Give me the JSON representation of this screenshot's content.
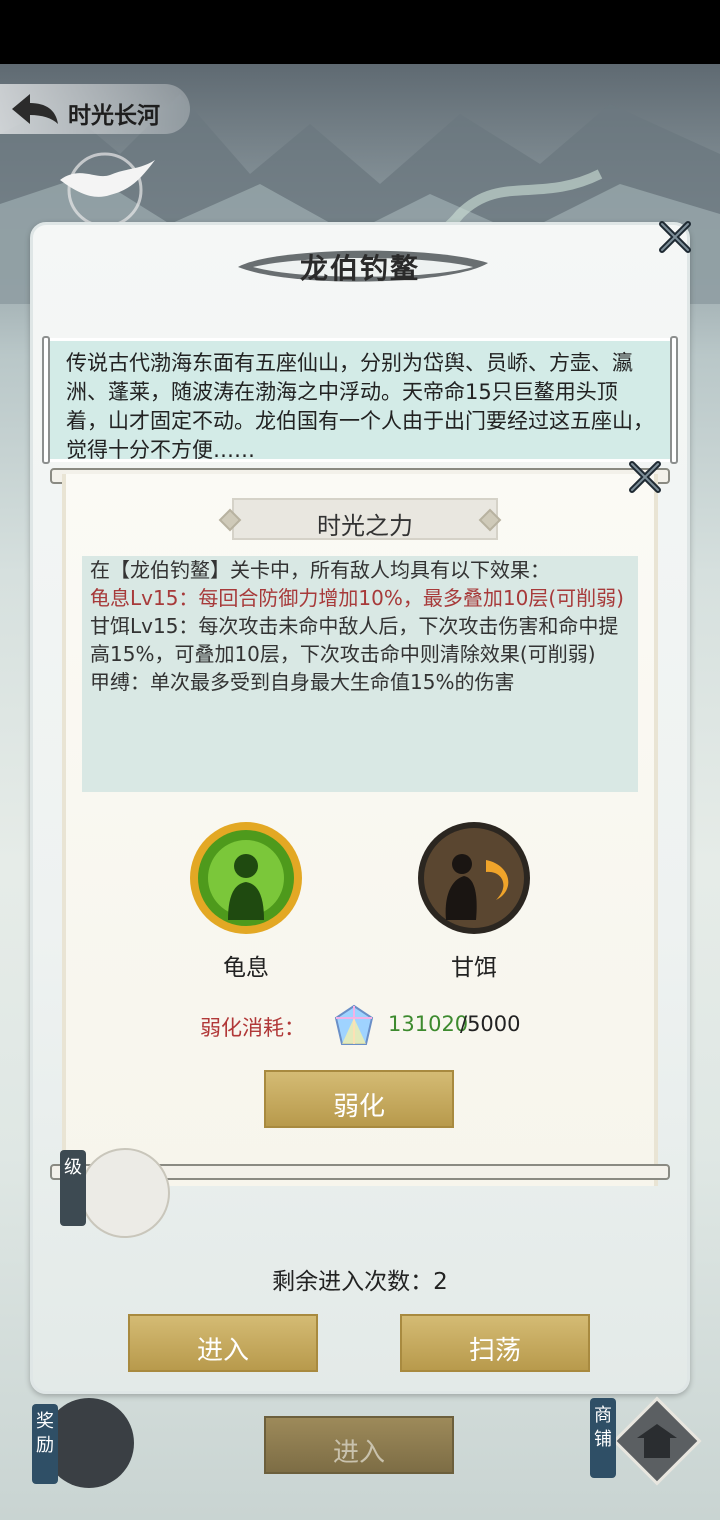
{
  "header": {
    "back_title": "时光长河"
  },
  "outer_dialog": {
    "title": "龙伯钓鳌",
    "description": "传说古代渤海东面有五座仙山，分别为岱舆、员峤、方壶、瀛洲、蓬莱，随波涛在渤海之中浮动。天帝命15只巨鳌用头顶着，山才固定不动。龙伯国有一个人由于出门要经过这五座山，觉得十分不方便……"
  },
  "popup": {
    "title": "时光之力",
    "effects": [
      {
        "text": "在【龙伯钓鳌】关卡中，所有敌人均具有以下效果：",
        "color": "#333333"
      },
      {
        "text": "龟息Lv15：每回合防御力增加10%，最多叠加10层(可削弱)",
        "color": "#a73a3a"
      },
      {
        "text": "甘饵Lv15：每次攻击未命中敌人后，下次攻击伤害和命中提高15%，可叠加10层，下次攻击命中则清除效果(可削弱)",
        "color": "#333333"
      },
      {
        "text": "甲缚：单次最多受到自身最大生命值15%的伤害",
        "color": "#333333"
      }
    ],
    "skills": [
      {
        "label": "龟息",
        "icon": "turtle-breath-icon"
      },
      {
        "label": "甘饵",
        "icon": "sweet-bait-icon"
      }
    ],
    "cost": {
      "label": "弱化消耗：",
      "have": "131020",
      "need": "/5000",
      "icon": "gem-icon"
    },
    "weaken_label": "弱化"
  },
  "remaining_label": "剩余进入次数：2",
  "buttons": {
    "enter": "进入",
    "sweep": "扫荡",
    "bottom_enter": "进入"
  },
  "bottom_tags": {
    "reward": "奖励",
    "shop": "商铺",
    "level_tag": "级"
  },
  "colors": {
    "gold": "#c9ad62",
    "red_text": "#b13838",
    "green_text": "#3d8a2e"
  }
}
